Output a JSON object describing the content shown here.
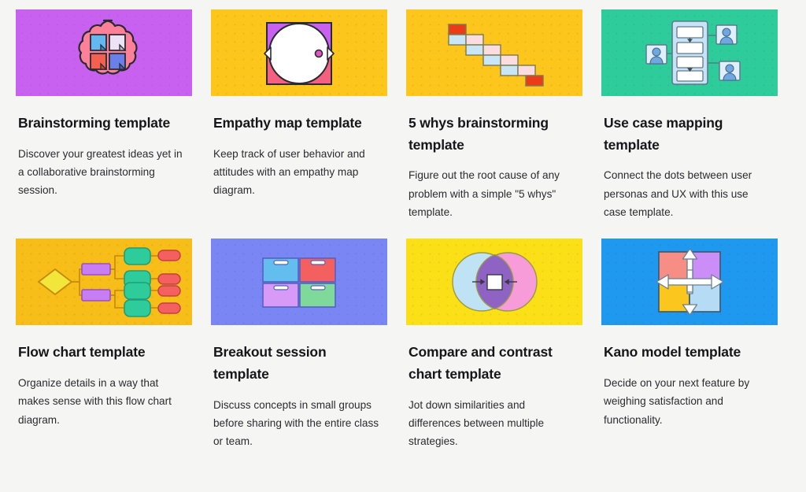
{
  "gallery": {
    "name": "template-gallery",
    "background_color": "#f5f5f3",
    "cards": [
      {
        "id": "brainstorming",
        "title": "Brainstorming template",
        "description": "Discover your greatest ideas yet in a collaborative brainstorming session.",
        "thumbnail": {
          "icon": "brain-sticky-notes-icon",
          "background_color": "#c961f0",
          "accent_colors": [
            "#fb8098",
            "#62b8ef",
            "#ece3f7",
            "#f4604f",
            "#6b7fe8"
          ]
        }
      },
      {
        "id": "empathy-map",
        "title": "Empathy map template",
        "description": "Keep track of user behavior and attitudes with an empathy map diagram.",
        "thumbnail": {
          "icon": "empathy-map-circle-icon",
          "background_color": "#fcc61d",
          "accent_colors": [
            "#c961f0",
            "#f4607f",
            "#ffffff"
          ]
        }
      },
      {
        "id": "5-whys-brainstorming",
        "title": "5 whys brainstorming template",
        "description": "Figure out the root cause of any problem with a simple \"5 whys\" template.",
        "thumbnail": {
          "icon": "staircase-boxes-icon",
          "background_color": "#fcc61d",
          "accent_colors": [
            "#ea3c16",
            "#c9e6f7",
            "#fbdde0"
          ]
        }
      },
      {
        "id": "use-case-mapping",
        "title": "Use case mapping template",
        "description": "Connect the dots between user personas and UX with this use case template.",
        "thumbnail": {
          "icon": "use-case-flow-icon",
          "background_color": "#2ecc9a",
          "accent_colors": [
            "#cfe6f7",
            "#ffffff",
            "#6fa8e0"
          ]
        }
      },
      {
        "id": "flow-chart",
        "title": "Flow chart template",
        "description": "Organize details in a way that makes sense with this flow chart diagram.",
        "thumbnail": {
          "icon": "flow-chart-nodes-icon",
          "background_color": "#f7bd18",
          "accent_colors": [
            "#f2e63b",
            "#c77ef5",
            "#2ecc9a",
            "#f4605f"
          ]
        }
      },
      {
        "id": "breakout-session",
        "title": "Breakout session template",
        "description": "Discuss concepts in small groups before sharing with the entire class or team.",
        "thumbnail": {
          "icon": "four-group-boxes-icon",
          "background_color": "#7b86f5",
          "accent_colors": [
            "#63bdef",
            "#f4605f",
            "#d79bf7",
            "#7ed99a"
          ]
        }
      },
      {
        "id": "compare-and-contrast",
        "title": "Compare and contrast chart template",
        "description": "Jot down similarities and differences between multiple strategies.",
        "thumbnail": {
          "icon": "venn-diagram-icon",
          "background_color": "#fbe017",
          "accent_colors": [
            "#bfe2f5",
            "#f79bd9",
            "#8f63c4",
            "#ffffff"
          ]
        }
      },
      {
        "id": "kano-model",
        "title": "Kano model template",
        "description": "Decide on your next feature by weighing satisfaction and functionality.",
        "thumbnail": {
          "icon": "kano-quadrant-icon",
          "background_color": "#1f99f0",
          "accent_colors": [
            "#f78e85",
            "#cb8df7",
            "#fbc61d",
            "#b6dcf5",
            "#ffffff"
          ]
        }
      }
    ]
  }
}
